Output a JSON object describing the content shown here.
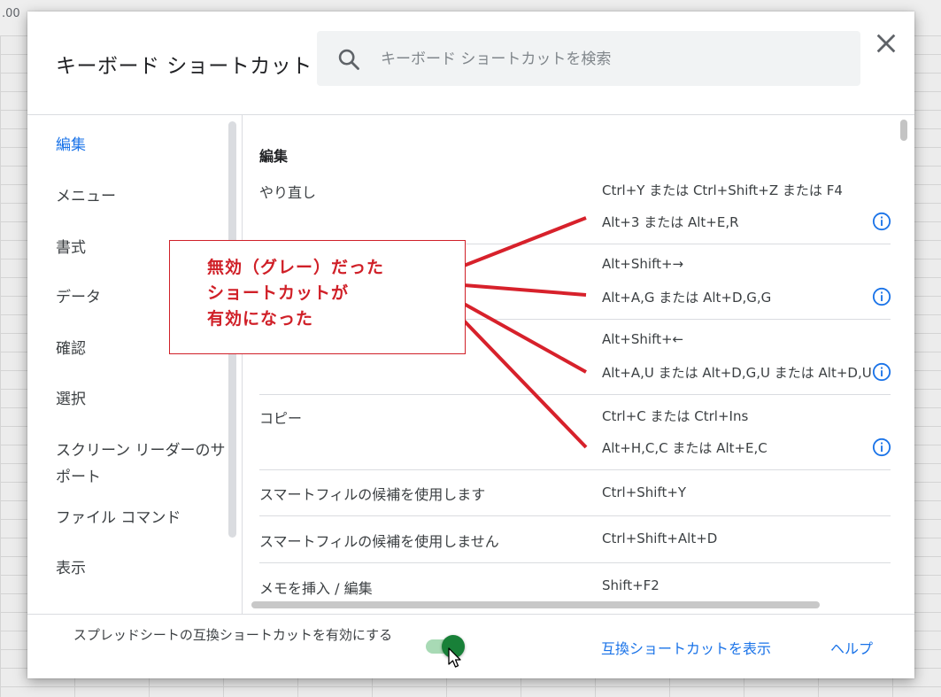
{
  "dialog": {
    "title": "キーボード ショートカット",
    "search_placeholder": "キーボード ショートカットを検索",
    "search_value": ""
  },
  "toolbar": {
    "left_label": ".00"
  },
  "sidebar": {
    "items": [
      {
        "label": "編集",
        "active": true
      },
      {
        "label": "メニュー"
      },
      {
        "label": "書式"
      },
      {
        "label": "データ"
      },
      {
        "label": "確認"
      },
      {
        "label": "選択"
      },
      {
        "label": "スクリーン リーダーのサ",
        "label2": "ポート"
      },
      {
        "label": "ファイル コマンド"
      },
      {
        "label": "表示"
      }
    ]
  },
  "main": {
    "section_title": "編集",
    "rows": [
      {
        "label": "やり直し",
        "keys": [
          "Ctrl+Y または Ctrl+Shift+Z または F4",
          "Alt+3 または Alt+E,R"
        ],
        "info": true
      },
      {
        "label": "",
        "keys": [
          "Alt+Shift+→",
          "Alt+A,G または Alt+D,G,G"
        ],
        "info": true
      },
      {
        "label": "",
        "keys": [
          "Alt+Shift+←",
          "Alt+A,U または Alt+D,G,U または Alt+D,U"
        ],
        "info": true
      },
      {
        "label": "コピー",
        "keys": [
          "Ctrl+C または Ctrl+Ins",
          "Alt+H,C,C または Alt+E,C"
        ],
        "info": true
      },
      {
        "label": "スマートフィルの候補を使用します",
        "keys": [
          "Ctrl+Shift+Y"
        ]
      },
      {
        "label": "スマートフィルの候補を使用しません",
        "keys": [
          "Ctrl+Shift+Alt+D"
        ]
      },
      {
        "label": "メモを挿入 / 編集",
        "keys": [
          "Shift+F2"
        ]
      }
    ]
  },
  "footer": {
    "toggle_label": "スプレッドシートの互換ショートカットを有効にする",
    "toggle_on": true,
    "show_compat_link": "互換ショートカットを表示",
    "help_link": "ヘルプ"
  },
  "annotation": {
    "text": "無効（グレー）だった\nショートカットが\n有効になった",
    "color": "#d02028"
  },
  "colors": {
    "accent": "#1a73e8",
    "toggle_on": "#188038",
    "annotation": "#d02028"
  }
}
